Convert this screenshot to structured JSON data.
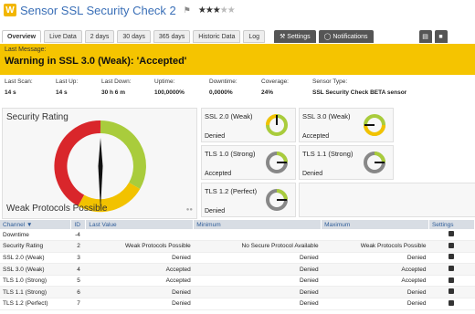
{
  "header": {
    "logo_letter": "W",
    "title": "Sensor SSL Security Check 2",
    "flag_icon": "flag-icon",
    "stars_filled": 3,
    "stars_total": 5
  },
  "tabs": [
    {
      "label": "Overview",
      "active": true
    },
    {
      "label": "Live Data"
    },
    {
      "label": "2 days"
    },
    {
      "label": "30 days"
    },
    {
      "label": "365 days"
    },
    {
      "label": "Historic Data"
    },
    {
      "label": "Log"
    }
  ],
  "actions": {
    "settings_label": "Settings",
    "notifications_label": "Notifications"
  },
  "banner": {
    "label": "Last Message:",
    "message": "Warning in SSL 3.0 (Weak): 'Accepted'",
    "color": "#f5c400"
  },
  "stats": [
    {
      "key": "Last Scan:",
      "value": "14 s"
    },
    {
      "key": "Last Up:",
      "value": "14 s"
    },
    {
      "key": "Last Down:",
      "value": "30 h 6 m"
    },
    {
      "key": "Uptime:",
      "value": "100,0000%"
    },
    {
      "key": "Downtime:",
      "value": "0,0000%"
    },
    {
      "key": "Coverage:",
      "value": "24%"
    },
    {
      "key": "Sensor Type:",
      "value": "SSL Security Check BETA sensor"
    }
  ],
  "rating": {
    "title": "Security Rating",
    "value": "Weak Protocols Possible"
  },
  "tiles": [
    {
      "name": "SSL 2.0 (Weak)",
      "value": "Denied"
    },
    {
      "name": "SSL 3.0 (Weak)",
      "value": "Accepted"
    },
    {
      "name": "TLS 1.0 (Strong)",
      "value": "Accepted"
    },
    {
      "name": "TLS 1.1 (Strong)",
      "value": "Denied"
    },
    {
      "name": "TLS 1.2 (Perfect)",
      "value": "Denied"
    }
  ],
  "table": {
    "headers": [
      "Channel",
      "ID",
      "Last Value",
      "Minimum",
      "Maximum",
      "Settings"
    ],
    "rows": [
      [
        "Downtime",
        "-4",
        "",
        "",
        ""
      ],
      [
        "Security Rating",
        "2",
        "Weak Protocols Possible",
        "No Secure Protocol Available",
        "Weak Protocols Possible"
      ],
      [
        "SSL 2.0 (Weak)",
        "3",
        "Denied",
        "Denied",
        "Denied"
      ],
      [
        "SSL 3.0 (Weak)",
        "4",
        "Accepted",
        "Denied",
        "Accepted"
      ],
      [
        "TLS 1.0 (Strong)",
        "5",
        "Accepted",
        "Denied",
        "Accepted"
      ],
      [
        "TLS 1.1 (Strong)",
        "6",
        "Denied",
        "Denied",
        "Denied"
      ],
      [
        "TLS 1.2 (Perfect)",
        "7",
        "Denied",
        "Denied",
        "Denied"
      ]
    ]
  }
}
